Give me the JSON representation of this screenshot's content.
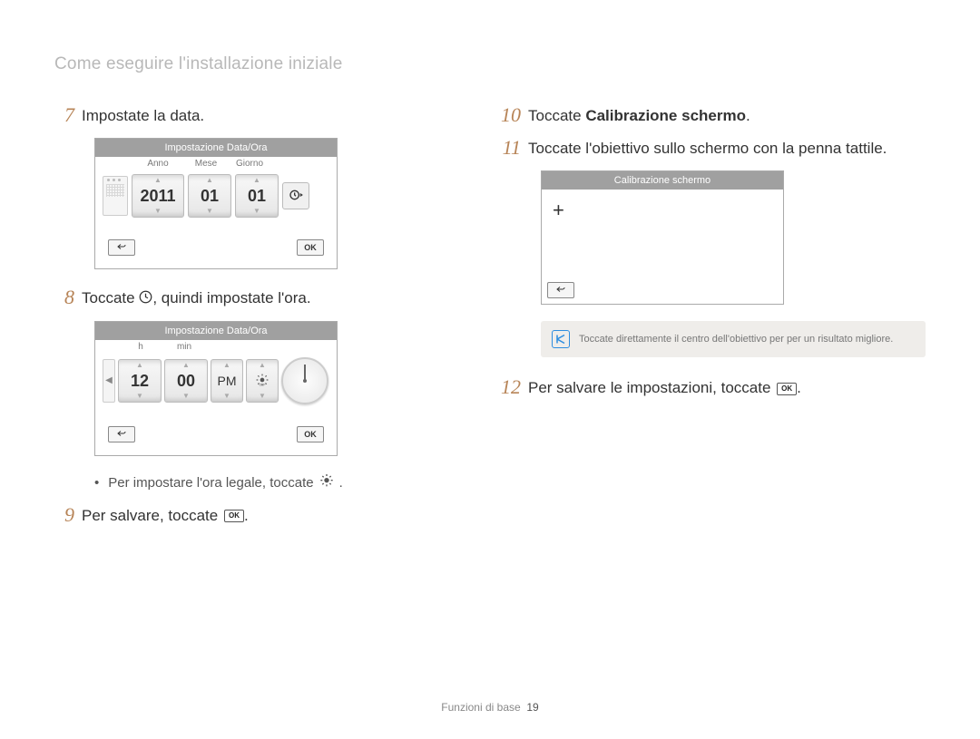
{
  "page_title": "Come eseguire l'installazione iniziale",
  "left": {
    "step7": {
      "num": "7",
      "text": "Impostate la data."
    },
    "date_screen": {
      "title": "Impostazione Data/Ora",
      "labels": {
        "year": "Anno",
        "month": "Mese",
        "day": "Giorno"
      },
      "values": {
        "year": "2011",
        "month": "01",
        "day": "01"
      },
      "ok": "OK"
    },
    "step8": {
      "num": "8",
      "text_prefix": "Toccate ",
      "text_suffix": ", quindi impostate l'ora."
    },
    "time_screen": {
      "title": "Impostazione Data/Ora",
      "labels": {
        "h": "h",
        "min": "min"
      },
      "values": {
        "h": "12",
        "min": "00",
        "ampm": "PM"
      },
      "ok": "OK"
    },
    "bullet_dst": "Per impostare l'ora legale, toccate ",
    "step9": {
      "num": "9",
      "text": "Per salvare, toccate "
    }
  },
  "right": {
    "step10": {
      "num": "10",
      "text_prefix": "Toccate ",
      "bold": "Calibrazione schermo",
      "text_suffix": "."
    },
    "step11": {
      "num": "11",
      "text": "Toccate l'obiettivo sullo schermo con la penna tattile."
    },
    "calib_screen": {
      "title": "Calibrazione schermo"
    },
    "info": "Toccate direttamente il centro dell'obiettivo per per un risultato migliore.",
    "step12": {
      "num": "12",
      "text": "Per salvare le impostazioni, toccate "
    }
  },
  "footer": {
    "section": "Funzioni di base",
    "page": "19"
  }
}
